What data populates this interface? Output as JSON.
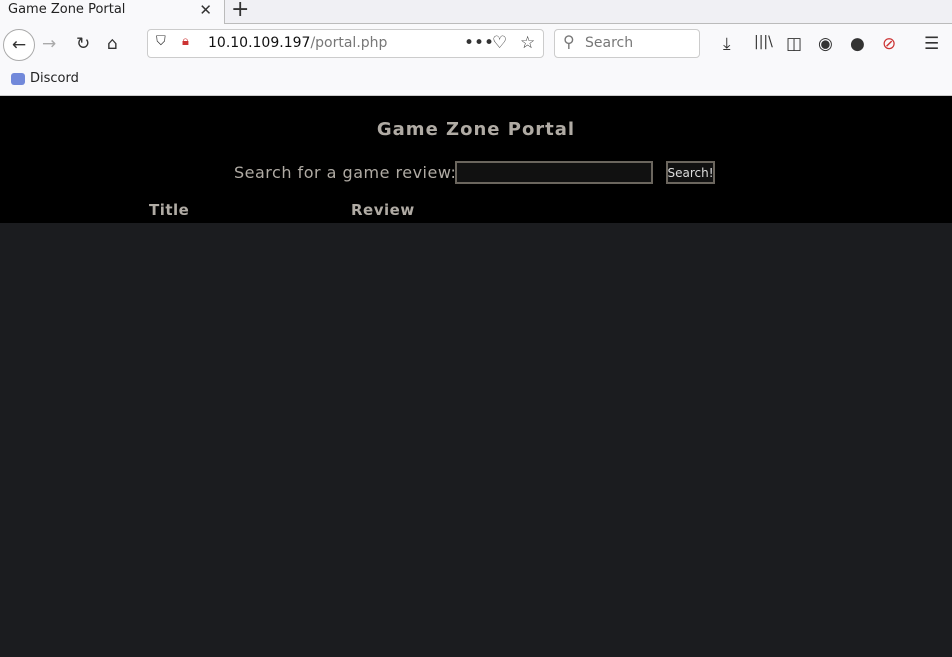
{
  "browser": {
    "tab_title": "Game Zone Portal",
    "url_host": "10.10.109.197",
    "url_path": "/portal.php",
    "search_placeholder": "Search",
    "bookmarks": [
      {
        "label": "Discord",
        "icon": "discord-icon"
      }
    ]
  },
  "page": {
    "title": "Game Zone Portal",
    "search_label": "Search for a game review:",
    "search_value": "",
    "search_button": "Search!",
    "columns": [
      "Title",
      "Review"
    ]
  },
  "colors": {
    "header_bg": "#000000",
    "body_bg": "#1b1c1f",
    "text": "#b0aba4"
  }
}
